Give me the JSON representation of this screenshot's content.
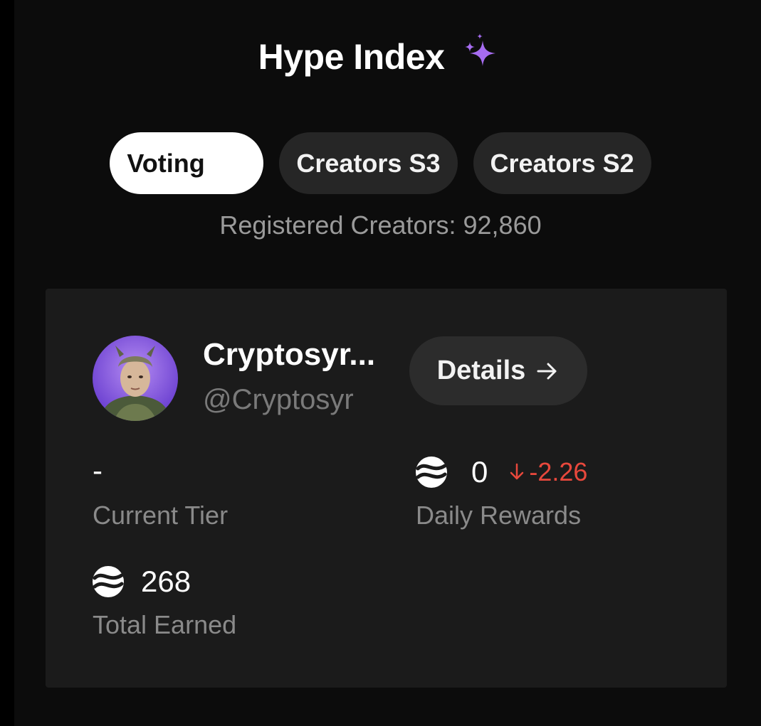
{
  "header": {
    "title": "Hype Index",
    "title_icon": "sparkle-icon",
    "accent_color": "#a66cf0"
  },
  "tabs": [
    {
      "label": "Voting",
      "active": true
    },
    {
      "label": "Creators S3",
      "active": false
    },
    {
      "label": "Creators S2",
      "active": false
    }
  ],
  "registered": "Registered Creators: 92,860",
  "creator": {
    "name": "Cryptosyr...",
    "handle": "@Cryptosyr",
    "avatar_icon": "avatar-portrait",
    "details_label": "Details",
    "details_icon": "arrow-right-icon"
  },
  "stats": {
    "current_tier": {
      "value": "-",
      "label": "Current Tier"
    },
    "daily_rewards": {
      "value": "0",
      "change": "-2.26",
      "change_icon": "arrow-down-icon",
      "change_color": "#e8483c",
      "label": "Daily Rewards",
      "icon": "coin-icon"
    },
    "total_earned": {
      "value": "268",
      "label": "Total Earned",
      "icon": "coin-icon"
    }
  }
}
